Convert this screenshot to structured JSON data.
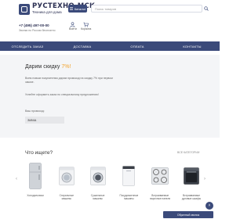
{
  "header": {
    "brand": "РУСТЕХНО-МСК",
    "tagline": "Техника для дома",
    "catalog_label": "Каталог",
    "search_placeholder": "Поиск товаров",
    "phone": "+7 (495) 497-00-00",
    "phone_sub": "Звонки по России бесплатно",
    "tools": [
      {
        "label": "Войти",
        "icon": "user-icon"
      },
      {
        "label": "Корзина",
        "icon": "cart-icon"
      }
    ]
  },
  "nav": {
    "items": [
      "ОТСЛЕДИТЬ ЗАКАЗ",
      "ДОСТАВКА",
      "ОПЛАТА",
      "КОНТАКТЫ"
    ]
  },
  "promo": {
    "title_prefix": "Дарим скидку ",
    "title_pct": "7%!",
    "text1": "Всем новым покупателям дарим промокод на скидку 7% при первом заказе.",
    "text2": "Успейте оформить заказ по специальному предложению!",
    "code_label": "Ваш промокод:",
    "code_value": "ЗИМА"
  },
  "categories": {
    "title": "Что ищете?",
    "all_label": "ВСЕ КАТЕГОРИИ",
    "items": [
      {
        "label": "Холодильники",
        "icon": "fridge-icon"
      },
      {
        "label": "Стиральные машины",
        "icon": "washer-icon"
      },
      {
        "label": "Сушильные машины",
        "icon": "dryer-icon"
      },
      {
        "label": "Посудомоечные машины",
        "icon": "dishwasher-icon"
      },
      {
        "label": "Встраиваемые варочные панели",
        "icon": "hob-icon"
      },
      {
        "label": "Встраиваемые духовые шкафы",
        "icon": "oven-icon"
      }
    ]
  },
  "callback_label": "Обратный звонок",
  "colors": {
    "primary": "#3b4a7a",
    "accent": "#f2a42e",
    "promo_bg": "#f4f5f7"
  }
}
